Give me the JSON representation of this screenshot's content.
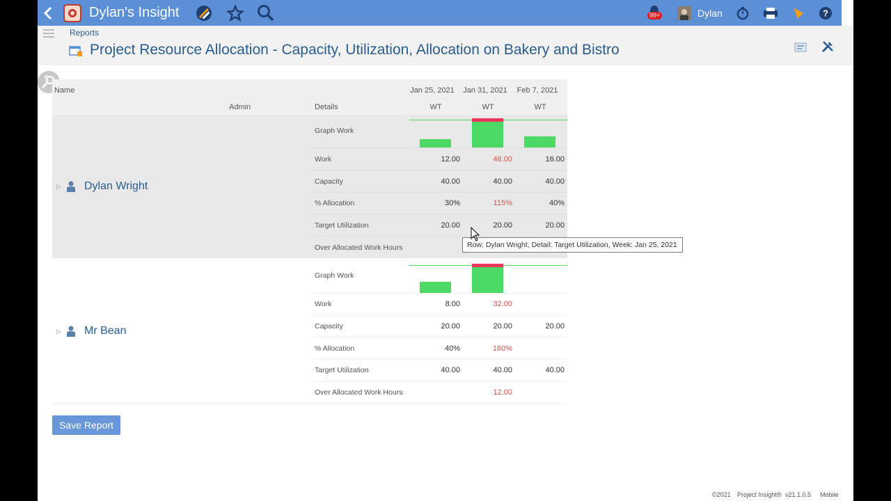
{
  "topbar": {
    "app_title": "Dylan's Insight",
    "notification_count": "99+",
    "user_name": "Dylan"
  },
  "header": {
    "breadcrumb": "Reports",
    "page_title": "Project Resource Allocation - Capacity, Utilization, Allocation on Bakery and Bistro"
  },
  "table": {
    "name_header": "Name",
    "admin_header": "Admin",
    "details_header": "Details",
    "weeks": [
      {
        "date": "Jan 25, 2021",
        "sub": "WT"
      },
      {
        "date": "Jan 31, 2021",
        "sub": "WT"
      },
      {
        "date": "Feb 7, 2021",
        "sub": "WT"
      }
    ],
    "detail_labels": [
      "Graph Work",
      "Work",
      "Capacity",
      "% Allocation",
      "Target Utilization",
      "Over Allocated Work Hours"
    ],
    "rows": [
      {
        "name": "Dylan Wright",
        "work": [
          "12.00",
          "46.00",
          "16.00"
        ],
        "capacity": [
          "40.00",
          "40.00",
          "40.00"
        ],
        "allocation": [
          "30%",
          "115%",
          "40%"
        ],
        "target": [
          "20.00",
          "20.00",
          "20.00"
        ],
        "over": [
          "",
          "",
          ""
        ],
        "graph": [
          {
            "work": 12,
            "capacity": 40
          },
          {
            "work": 46,
            "capacity": 40
          },
          {
            "work": 16,
            "capacity": 40
          }
        ]
      },
      {
        "name": "Mr Bean",
        "work": [
          "8.00",
          "32.00",
          ""
        ],
        "capacity": [
          "20.00",
          "20.00",
          "20.00"
        ],
        "allocation": [
          "40%",
          "160%",
          ""
        ],
        "target": [
          "40.00",
          "40.00",
          "40.00"
        ],
        "over": [
          "",
          "12.00",
          ""
        ],
        "graph": [
          {
            "work": 8,
            "capacity": 20
          },
          {
            "work": 32,
            "capacity": 20
          },
          {
            "work": 0,
            "capacity": 20
          }
        ]
      }
    ]
  },
  "tooltip": "Row: Dylan Wright, Detail: Target Utilization, Week: Jan 25, 2021",
  "save_button": "Save Report",
  "footer": {
    "copyright": "©2021",
    "brand": "Project Insight®",
    "version": "v21.1.0.5",
    "mobile": "Mobile"
  },
  "colors": {
    "topbar": "#5b8fd6",
    "work_bar": "#4cd964",
    "over_bar": "#e8375a",
    "over_value": "#d9534f"
  }
}
